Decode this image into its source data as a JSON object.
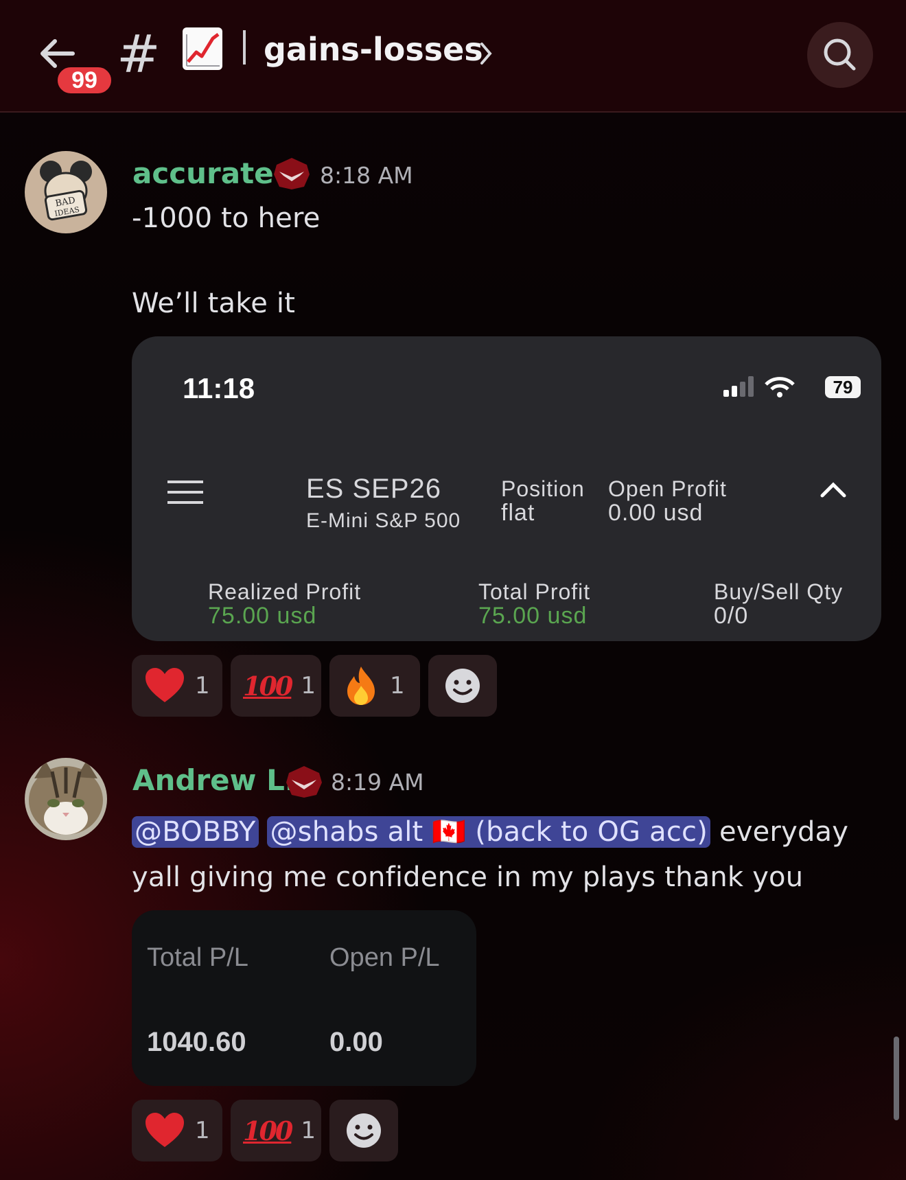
{
  "header": {
    "unread_count": "99",
    "channel_hash": "#",
    "channel_emoji": "chart-increasing-icon",
    "channel_name": "gains-losses"
  },
  "messages": [
    {
      "username": "accurate",
      "timestamp": "8:18 AM",
      "line1": "-1000 to here",
      "line2": "We’ll take it",
      "embed": {
        "phone_time": "11:18",
        "battery": "79",
        "symbol": "ES SEP26",
        "symbol_name": "E-Mini S&P 500",
        "position_label": "Position",
        "position_value": "flat",
        "open_profit_label": "Open Profit",
        "open_profit_value": "0.00 usd",
        "realized_label": "Realized Profit",
        "realized_value": "75.00 usd",
        "total_label": "Total Profit",
        "total_value": "75.00 usd",
        "qty_label": "Buy/Sell Qty",
        "qty_value": "0/0"
      },
      "reactions": [
        {
          "emoji": "heart-icon",
          "count": "1"
        },
        {
          "emoji": "100-icon",
          "label": "100",
          "count": "1"
        },
        {
          "emoji": "fire-icon",
          "count": "1"
        }
      ]
    },
    {
      "username": "Andrew L.",
      "timestamp": "8:19 AM",
      "mention1": "@BOBBY",
      "mention2": "@shabs alt 🇨🇦 (back to OG acc)",
      "text_after": " everyday",
      "text_line2": "yall giving me confidence in my plays thank you",
      "embed": {
        "total_pl_label": "Total P/L",
        "open_pl_label": "Open P/L",
        "total_pl_value": "1040.60",
        "open_pl_value": "0.00"
      },
      "reactions": [
        {
          "emoji": "heart-icon",
          "count": "1"
        },
        {
          "emoji": "100-icon",
          "label": "100",
          "count": "1"
        }
      ]
    }
  ],
  "colors": {
    "header_bg": "#1e0407",
    "username": "#5fbf8a",
    "mention_bg": "#3f4596",
    "profit_green": "#5aa550",
    "badge_red": "#e5393f"
  }
}
